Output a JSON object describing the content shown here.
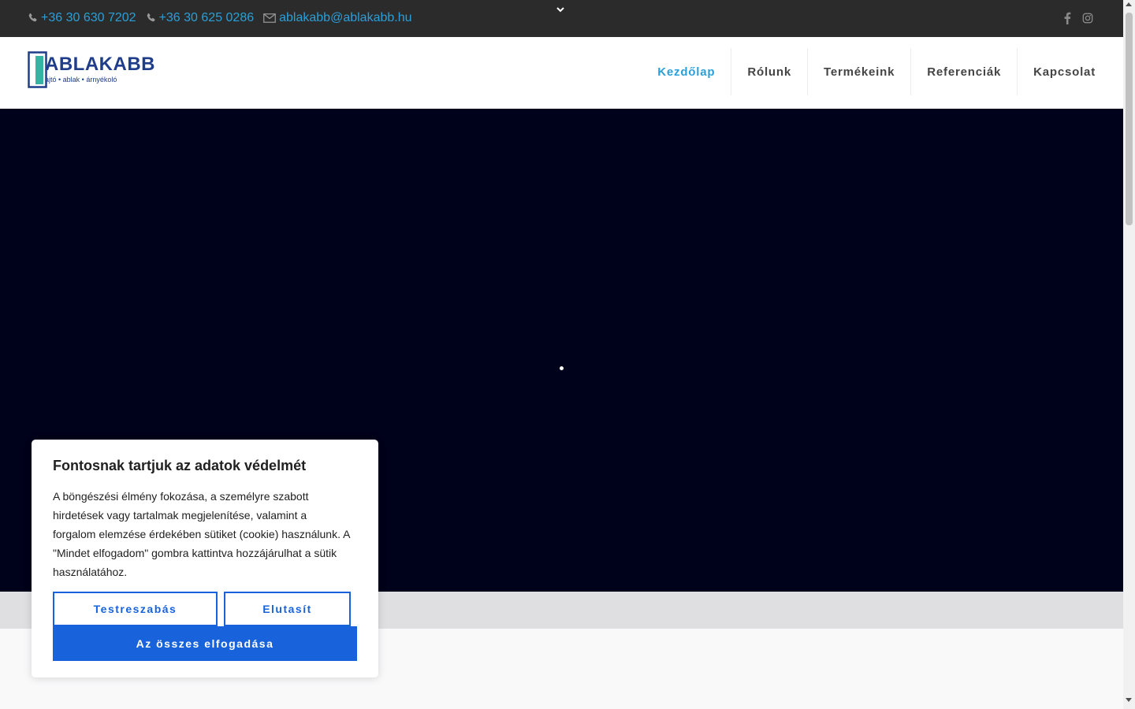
{
  "topbar": {
    "contacts": [
      {
        "type": "phone",
        "icon": "phone-icon",
        "text": "+36 30 630 7202"
      },
      {
        "type": "phone",
        "icon": "phone-icon",
        "text": "+36 30 625 0286"
      },
      {
        "type": "email",
        "icon": "envelope-icon",
        "text": "ablakabb@ablakabb.hu"
      }
    ],
    "social": [
      "facebook-icon",
      "instagram-icon"
    ],
    "link_color": "#2a9fd8",
    "background": "#2b2b2b"
  },
  "header": {
    "logo": {
      "brand": "ABLAKABB",
      "tagline": "ajtó • ablak • árnyékoló"
    },
    "nav": [
      {
        "label": "Kezdőlap",
        "active": true
      },
      {
        "label": "Rólunk",
        "active": false
      },
      {
        "label": "Termékeink",
        "active": false
      },
      {
        "label": "Referenciák",
        "active": false
      },
      {
        "label": "Kapcsolat",
        "active": false
      }
    ],
    "active_color": "#2a9fd8"
  },
  "hero": {
    "background": "#00011a"
  },
  "cookie_banner": {
    "title": "Fontosnak tartjuk az adatok védelmét",
    "text": "A böngészési élmény fokozása, a személyre szabott hirdetések vagy tartalmak megjelenítése, valamint a forgalom elemzése érdekében sütiket (cookie) használunk. A \"Mindet elfogadom\" gombra kattintva hozzájárulhat a sütik használatához.",
    "customize_label": "Testreszabás",
    "reject_label": "Elutasít",
    "accept_label": "Az összes elfogadása",
    "button_color": "#1863dc"
  }
}
